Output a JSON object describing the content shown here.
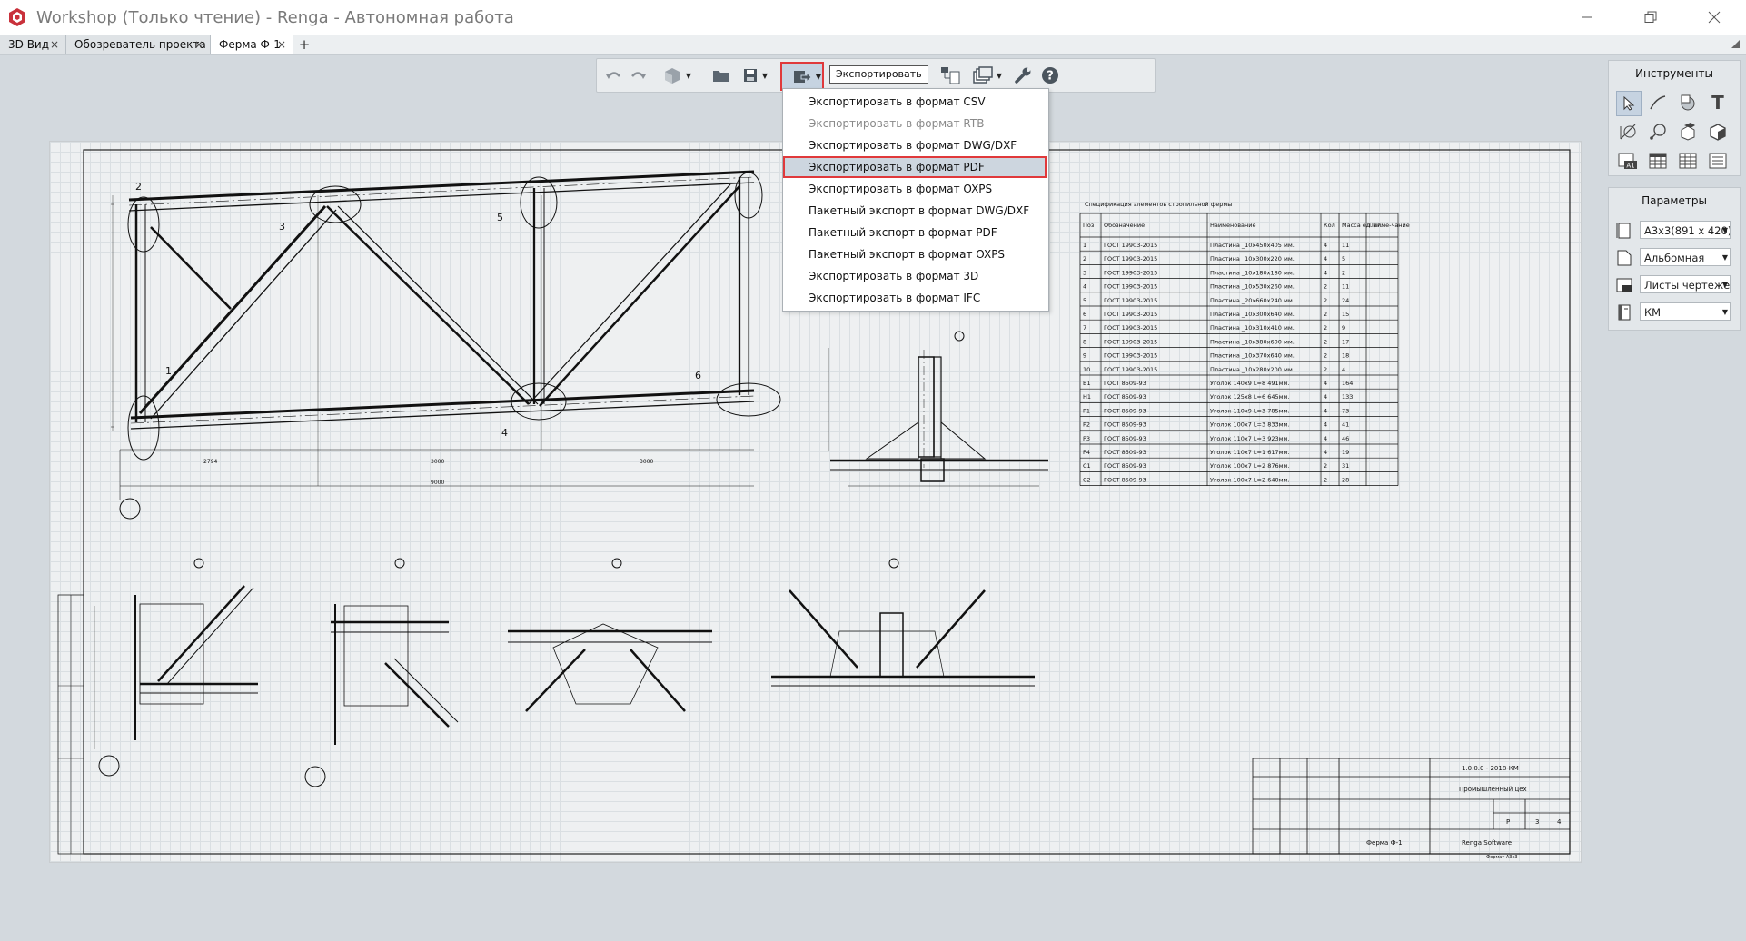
{
  "window": {
    "title": "Workshop (Только чтение) - Renga - Автономная работа"
  },
  "tabs": [
    {
      "label": "3D Вид"
    },
    {
      "label": "Обозреватель проекта"
    },
    {
      "label": "Ферма Ф-1"
    }
  ],
  "toolbar": {
    "tooltip": "Экспортировать"
  },
  "export_menu": {
    "items": [
      {
        "label": "Экспортировать в формат CSV"
      },
      {
        "label": "Экспортировать в формат RTB"
      },
      {
        "label": "Экспортировать в формат DWG/DXF"
      },
      {
        "label": "Экспортировать в формат PDF"
      },
      {
        "label": "Экспортировать в формат OXPS"
      },
      {
        "label": "Пакетный экспорт в формат DWG/DXF"
      },
      {
        "label": "Пакетный экспорт в формат PDF"
      },
      {
        "label": "Пакетный экспорт в формат OXPS"
      },
      {
        "label": "Экспортировать в формат 3D"
      },
      {
        "label": "Экспортировать в формат IFC"
      }
    ]
  },
  "tools_panel": {
    "title": "Инструменты"
  },
  "params_panel": {
    "title": "Параметры",
    "fields": [
      {
        "value": "А3х3(891 х 420)",
        "icon": "sheet-format-icon"
      },
      {
        "value": "Альбомная",
        "icon": "orientation-icon"
      },
      {
        "value": "Листы чертежей",
        "icon": "stamp-icon"
      },
      {
        "value": "КМ",
        "icon": "book-icon"
      }
    ]
  },
  "drawing": {
    "callouts": [
      "1",
      "2",
      "3",
      "4",
      "5",
      "6"
    ],
    "dims_bottom": [
      "2794",
      "3000",
      "3000"
    ],
    "dim_total": "9000",
    "dim_top": "-",
    "spec_table": {
      "title": "Спецификация элементов стропильной фермы",
      "headers": [
        "Поз",
        "Обозначение",
        "Наименование",
        "Кол",
        "Масса ед. кг.",
        "Приме-чание"
      ],
      "rows": [
        [
          "1",
          "ГОСТ 19903-2015",
          "Пластина _10х450х405 мм.",
          "4",
          "11",
          ""
        ],
        [
          "2",
          "ГОСТ 19903-2015",
          "Пластина _10х300х220 мм.",
          "4",
          "5",
          ""
        ],
        [
          "3",
          "ГОСТ 19903-2015",
          "Пластина _10х180х180 мм.",
          "4",
          "2",
          ""
        ],
        [
          "4",
          "ГОСТ 19903-2015",
          "Пластина _10х530х260 мм.",
          "2",
          "11",
          ""
        ],
        [
          "5",
          "ГОСТ 19903-2015",
          "Пластина _20х660х240 мм.",
          "2",
          "24",
          ""
        ],
        [
          "6",
          "ГОСТ 19903-2015",
          "Пластина _10х300х640 мм.",
          "2",
          "15",
          ""
        ],
        [
          "7",
          "ГОСТ 19903-2015",
          "Пластина _10х310х410 мм.",
          "2",
          "9",
          ""
        ],
        [
          "8",
          "ГОСТ 19903-2015",
          "Пластина _10х380х600 мм.",
          "2",
          "17",
          ""
        ],
        [
          "9",
          "ГОСТ 19903-2015",
          "Пластина _10х370х640 мм.",
          "2",
          "18",
          ""
        ],
        [
          "10",
          "ГОСТ 19903-2015",
          "Пластина _10х280х200 мм.",
          "2",
          "4",
          ""
        ],
        [
          "В1",
          "ГОСТ 8509-93",
          "Уголок 140х9 L=8 491мм.",
          "4",
          "164",
          ""
        ],
        [
          "Н1",
          "ГОСТ 8509-93",
          "Уголок 125х8 L=6 645мм.",
          "4",
          "133",
          ""
        ],
        [
          "Р1",
          "ГОСТ 8509-93",
          "Уголок 110х9 L=3 785мм.",
          "4",
          "73",
          ""
        ],
        [
          "Р2",
          "ГОСТ 8509-93",
          "Уголок 100х7 L=3 833мм.",
          "4",
          "41",
          ""
        ],
        [
          "Р3",
          "ГОСТ 8509-93",
          "Уголок 110х7 L=3 923мм.",
          "4",
          "46",
          ""
        ],
        [
          "Р4",
          "ГОСТ 8509-93",
          "Уголок 110х7 L=1 617мм.",
          "4",
          "19",
          ""
        ],
        [
          "С1",
          "ГОСТ 8509-93",
          "Уголок 100х7 L=2 876мм.",
          "2",
          "31",
          ""
        ],
        [
          "С2",
          "ГОСТ 8509-93",
          "Уголок 100х7 L=2 640мм.",
          "2",
          "28",
          ""
        ]
      ]
    },
    "title_block": {
      "code": "1.0.0.0 - 2018-КМ",
      "project": "Промышленный цех",
      "stage": "Р",
      "sheet": "3",
      "sheets": "4",
      "drawing_name": "Ферма Ф-1",
      "company": "Renga Software",
      "format": "Формат A3x3"
    }
  }
}
